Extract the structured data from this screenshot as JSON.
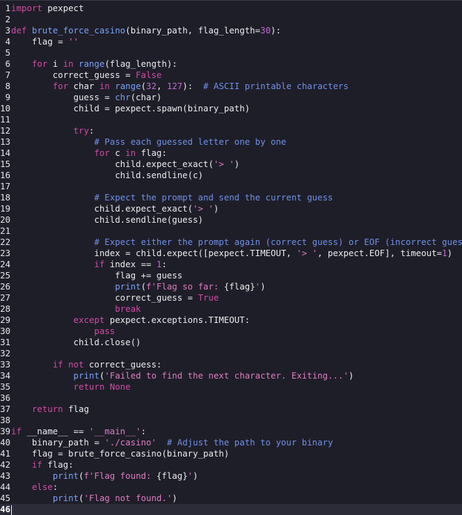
{
  "editor": {
    "current_line": 46,
    "lines": [
      {
        "n": "1",
        "t": [
          [
            "kw",
            "import"
          ],
          [
            "p",
            " pexpect"
          ]
        ]
      },
      {
        "n": "2",
        "t": []
      },
      {
        "n": "3",
        "t": [
          [
            "kw",
            "def"
          ],
          [
            "p",
            " "
          ],
          [
            "fn",
            "brute_force_casino"
          ],
          [
            "p",
            "(binary_path, flag_length="
          ],
          [
            "num",
            "30"
          ],
          [
            "p",
            "):"
          ]
        ]
      },
      {
        "n": "4",
        "t": [
          [
            "p",
            "    flag = "
          ],
          [
            "str",
            "''"
          ]
        ]
      },
      {
        "n": "5",
        "t": []
      },
      {
        "n": "6",
        "t": [
          [
            "p",
            "    "
          ],
          [
            "kw",
            "for"
          ],
          [
            "p",
            " i "
          ],
          [
            "kw",
            "in"
          ],
          [
            "p",
            " "
          ],
          [
            "fn",
            "range"
          ],
          [
            "p",
            "(flag_length):"
          ]
        ]
      },
      {
        "n": "7",
        "t": [
          [
            "p",
            "        correct_guess = "
          ],
          [
            "kw",
            "False"
          ]
        ]
      },
      {
        "n": "8",
        "t": [
          [
            "p",
            "        "
          ],
          [
            "kw",
            "for"
          ],
          [
            "p",
            " char "
          ],
          [
            "kw",
            "in"
          ],
          [
            "p",
            " "
          ],
          [
            "fn",
            "range"
          ],
          [
            "p",
            "("
          ],
          [
            "num",
            "32"
          ],
          [
            "p",
            ", "
          ],
          [
            "num",
            "127"
          ],
          [
            "p",
            "):  "
          ],
          [
            "cm",
            "# ASCII printable characters"
          ]
        ]
      },
      {
        "n": "9",
        "t": [
          [
            "p",
            "            guess = "
          ],
          [
            "fn",
            "chr"
          ],
          [
            "p",
            "(char)"
          ]
        ]
      },
      {
        "n": "10",
        "t": [
          [
            "p",
            "            child = pexpect.spawn(binary_path)"
          ]
        ]
      },
      {
        "n": "11",
        "t": []
      },
      {
        "n": "12",
        "t": [
          [
            "p",
            "            "
          ],
          [
            "kw",
            "try"
          ],
          [
            "p",
            ":"
          ]
        ]
      },
      {
        "n": "13",
        "t": [
          [
            "p",
            "                "
          ],
          [
            "cm",
            "# Pass each guessed letter one by one"
          ]
        ]
      },
      {
        "n": "14",
        "t": [
          [
            "p",
            "                "
          ],
          [
            "kw",
            "for"
          ],
          [
            "p",
            " c "
          ],
          [
            "kw",
            "in"
          ],
          [
            "p",
            " flag:"
          ]
        ]
      },
      {
        "n": "15",
        "t": [
          [
            "p",
            "                    child.expect_exact("
          ],
          [
            "str",
            "'> '"
          ],
          [
            "p",
            ")"
          ]
        ]
      },
      {
        "n": "16",
        "t": [
          [
            "p",
            "                    child.sendline(c)"
          ]
        ]
      },
      {
        "n": "17",
        "t": []
      },
      {
        "n": "18",
        "t": [
          [
            "p",
            "                "
          ],
          [
            "cm",
            "# Expect the prompt and send the current guess"
          ]
        ]
      },
      {
        "n": "19",
        "t": [
          [
            "p",
            "                child.expect_exact("
          ],
          [
            "str",
            "'> '"
          ],
          [
            "p",
            ")"
          ]
        ]
      },
      {
        "n": "20",
        "t": [
          [
            "p",
            "                child.sendline(guess)"
          ]
        ]
      },
      {
        "n": "21",
        "t": []
      },
      {
        "n": "22",
        "t": [
          [
            "p",
            "                "
          ],
          [
            "cm",
            "# Expect either the prompt again (correct guess) or EOF (incorrect guess)"
          ]
        ]
      },
      {
        "n": "23",
        "t": [
          [
            "p",
            "                index = child.expect([pexpect.TIMEOUT, "
          ],
          [
            "str",
            "'> '"
          ],
          [
            "p",
            ", pexpect.EOF], timeout="
          ],
          [
            "num",
            "1"
          ],
          [
            "p",
            ")"
          ]
        ]
      },
      {
        "n": "24",
        "t": [
          [
            "p",
            "                "
          ],
          [
            "kw",
            "if"
          ],
          [
            "p",
            " index == "
          ],
          [
            "num",
            "1"
          ],
          [
            "p",
            ":"
          ]
        ]
      },
      {
        "n": "25",
        "t": [
          [
            "p",
            "                    flag += guess"
          ]
        ]
      },
      {
        "n": "26",
        "t": [
          [
            "p",
            "                    "
          ],
          [
            "fn",
            "print"
          ],
          [
            "p",
            "("
          ],
          [
            "str",
            "f'Flag so far: "
          ],
          [
            "p",
            "{flag}"
          ],
          [
            "str",
            "'"
          ],
          [
            "p",
            ")"
          ]
        ]
      },
      {
        "n": "27",
        "t": [
          [
            "p",
            "                    correct_guess = "
          ],
          [
            "kw",
            "True"
          ]
        ]
      },
      {
        "n": "28",
        "t": [
          [
            "p",
            "                    "
          ],
          [
            "kw",
            "break"
          ]
        ]
      },
      {
        "n": "29",
        "t": [
          [
            "p",
            "            "
          ],
          [
            "kw",
            "except"
          ],
          [
            "p",
            " pexpect.exceptions.TIMEOUT:"
          ]
        ]
      },
      {
        "n": "30",
        "t": [
          [
            "p",
            "                "
          ],
          [
            "kw",
            "pass"
          ]
        ]
      },
      {
        "n": "31",
        "t": [
          [
            "p",
            "            child.close()"
          ]
        ]
      },
      {
        "n": "32",
        "t": []
      },
      {
        "n": "33",
        "t": [
          [
            "p",
            "        "
          ],
          [
            "kw",
            "if"
          ],
          [
            "p",
            " "
          ],
          [
            "kw",
            "not"
          ],
          [
            "p",
            " correct_guess:"
          ]
        ]
      },
      {
        "n": "34",
        "t": [
          [
            "p",
            "            "
          ],
          [
            "fn",
            "print"
          ],
          [
            "p",
            "("
          ],
          [
            "str",
            "'Failed to find the next character. Exiting...'"
          ],
          [
            "p",
            ")"
          ]
        ]
      },
      {
        "n": "35",
        "t": [
          [
            "p",
            "            "
          ],
          [
            "kw",
            "return"
          ],
          [
            "p",
            " "
          ],
          [
            "kw",
            "None"
          ]
        ]
      },
      {
        "n": "36",
        "t": []
      },
      {
        "n": "37",
        "t": [
          [
            "p",
            "    "
          ],
          [
            "kw",
            "return"
          ],
          [
            "p",
            " flag"
          ]
        ]
      },
      {
        "n": "38",
        "t": []
      },
      {
        "n": "39",
        "t": [
          [
            "kw",
            "if"
          ],
          [
            "p",
            " __name__ == "
          ],
          [
            "str",
            "'__main__'"
          ],
          [
            "p",
            ":"
          ]
        ]
      },
      {
        "n": "40",
        "t": [
          [
            "p",
            "    binary_path = "
          ],
          [
            "str",
            "'./casino'"
          ],
          [
            "p",
            "  "
          ],
          [
            "cm",
            "# Adjust the path to your binary"
          ]
        ]
      },
      {
        "n": "41",
        "t": [
          [
            "p",
            "    flag = brute_force_casino(binary_path)"
          ]
        ]
      },
      {
        "n": "42",
        "t": [
          [
            "p",
            "    "
          ],
          [
            "kw",
            "if"
          ],
          [
            "p",
            " flag:"
          ]
        ]
      },
      {
        "n": "43",
        "t": [
          [
            "p",
            "        "
          ],
          [
            "fn",
            "print"
          ],
          [
            "p",
            "("
          ],
          [
            "str",
            "f'Flag found: "
          ],
          [
            "p",
            "{flag}"
          ],
          [
            "str",
            "'"
          ],
          [
            "p",
            ")"
          ]
        ]
      },
      {
        "n": "44",
        "t": [
          [
            "p",
            "    "
          ],
          [
            "kw",
            "else"
          ],
          [
            "p",
            ":"
          ]
        ]
      },
      {
        "n": "45",
        "t": [
          [
            "p",
            "        "
          ],
          [
            "fn",
            "print"
          ],
          [
            "p",
            "("
          ],
          [
            "str",
            "'Flag not found.'"
          ],
          [
            "p",
            ")"
          ]
        ]
      },
      {
        "n": "46",
        "t": []
      }
    ]
  }
}
